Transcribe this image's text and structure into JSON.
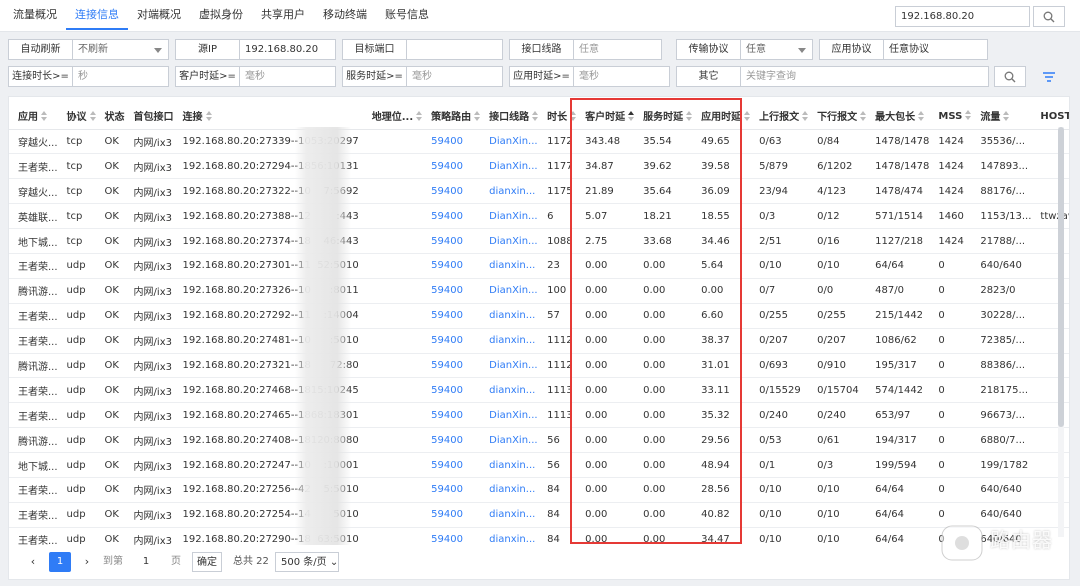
{
  "tabs": [
    {
      "label": "流量概况",
      "active": false
    },
    {
      "label": "连接信息",
      "active": true
    },
    {
      "label": "对端概况",
      "active": false
    },
    {
      "label": "虚拟身份",
      "active": false
    },
    {
      "label": "共享用户",
      "active": false
    },
    {
      "label": "移动终端",
      "active": false
    },
    {
      "label": "账号信息",
      "active": false
    }
  ],
  "global_search": {
    "value": "192.168.80.20",
    "icon": "search-icon"
  },
  "filters": {
    "auto_refresh": {
      "label": "自动刷新",
      "value": "不刷新"
    },
    "src_ip": {
      "label": "源IP",
      "value": "192.168.80.20"
    },
    "dst_port": {
      "label": "目标端口",
      "value": ""
    },
    "iface_line": {
      "label": "接口线路",
      "placeholder": "任意"
    },
    "transport": {
      "label": "传输协议",
      "value": "任意"
    },
    "app_proto": {
      "label": "应用协议",
      "value": "任意协议"
    },
    "conn_duration": {
      "label": "连接时长>=",
      "placeholder": "秒"
    },
    "client_delay": {
      "label": "客户时延>=",
      "placeholder": "毫秒"
    },
    "server_delay": {
      "label": "服务时延>=",
      "placeholder": "毫秒"
    },
    "app_delay": {
      "label": "应用时延>=",
      "placeholder": "毫秒"
    },
    "other": {
      "label": "其它",
      "placeholder": "关键字查询"
    }
  },
  "columns": [
    "应用",
    "协议",
    "状态",
    "首包接口",
    "连接",
    "地理位...",
    "策略路由",
    "接口线路",
    "时长",
    "客户时延",
    "服务时延",
    "应用时延",
    "上行报文",
    "下行报文",
    "最大包长",
    "MSS",
    "流量",
    "HOST"
  ],
  "rows": [
    [
      "穿越火...",
      "tcp",
      "OK",
      "内网/ix3",
      "192.168.80.20:27339--10",
      "53:20297",
      "",
      "59400",
      "DianXin...",
      "1172",
      "343.48",
      "35.54",
      "49.65",
      "0/63",
      "0/84",
      "1478/1478",
      "1424",
      "35536/...",
      ""
    ],
    [
      "王者荣...",
      "tcp",
      "OK",
      "内网/ix3",
      "192.168.80.20:27294--18",
      "56:10131",
      "",
      "59400",
      "DianXin...",
      "1177",
      "34.87",
      "39.62",
      "39.58",
      "5/879",
      "6/1202",
      "1478/1478",
      "1424",
      "147893...",
      ""
    ],
    [
      "穿越火...",
      "tcp",
      "OK",
      "内网/ix3",
      "192.168.80.20:27322--10",
      "7:5692",
      "",
      "59400",
      "dianxin...",
      "1175",
      "21.89",
      "35.64",
      "36.09",
      "23/94",
      "4/123",
      "1478/474",
      "1424",
      "88176/...",
      ""
    ],
    [
      "英雄联...",
      "tcp",
      "OK",
      "内网/ix3",
      "192.168.80.20:27388--12",
      ":443",
      "",
      "59400",
      "DianXin...",
      "6",
      "5.07",
      "18.21",
      "18.55",
      "0/3",
      "0/12",
      "571/1514",
      "1460",
      "1153/13...",
      "ttwzavat..."
    ],
    [
      "地下城...",
      "tcp",
      "OK",
      "内网/ix3",
      "192.168.80.20:27374--18",
      "46:443",
      "",
      "59400",
      "DianXin...",
      "1088",
      "2.75",
      "33.68",
      "34.46",
      "2/51",
      "0/16",
      "1127/218",
      "1424",
      "21788/...",
      ""
    ],
    [
      "王者荣...",
      "udp",
      "OK",
      "内网/ix3",
      "192.168.80.20:27301--11",
      "52:5010",
      "",
      "59400",
      "dianxin...",
      "23",
      "0.00",
      "0.00",
      "5.64",
      "0/10",
      "0/10",
      "64/64",
      "0",
      "640/640",
      ""
    ],
    [
      "腾讯游...",
      "udp",
      "OK",
      "内网/ix3",
      "192.168.80.20:27326--10",
      ":8011",
      "",
      "59400",
      "DianXin...",
      "100",
      "0.00",
      "0.00",
      "0.00",
      "0/7",
      "0/0",
      "487/0",
      "0",
      "2823/0",
      ""
    ],
    [
      "王者荣...",
      "udp",
      "OK",
      "内网/ix3",
      "192.168.80.20:27292--11",
      ":14004",
      "",
      "59400",
      "dianxin...",
      "57",
      "0.00",
      "0.00",
      "6.60",
      "0/255",
      "0/255",
      "215/1442",
      "0",
      "30228/...",
      ""
    ],
    [
      "王者荣...",
      "udp",
      "OK",
      "内网/ix3",
      "192.168.80.20:27481--10",
      ":5010",
      "",
      "59400",
      "dianxin...",
      "1112",
      "0.00",
      "0.00",
      "38.37",
      "0/207",
      "0/207",
      "1086/62",
      "0",
      "72385/...",
      ""
    ],
    [
      "腾讯游...",
      "udp",
      "OK",
      "内网/ix3",
      "192.168.80.20:27321--18",
      "72:80",
      "",
      "59400",
      "DianXin...",
      "1112",
      "0.00",
      "0.00",
      "31.01",
      "0/693",
      "0/910",
      "195/317",
      "0",
      "88386/...",
      ""
    ],
    [
      "王者荣...",
      "udp",
      "OK",
      "内网/ix3",
      "192.168.80.20:27468--18",
      "15:10245",
      "",
      "59400",
      "dianxin...",
      "1113",
      "0.00",
      "0.00",
      "33.11",
      "0/15529",
      "0/15704",
      "574/1442",
      "0",
      "218175...",
      ""
    ],
    [
      "王者荣...",
      "udp",
      "OK",
      "内网/ix3",
      "192.168.80.20:27465--18",
      "68:18301",
      "",
      "59400",
      "DianXin...",
      "1113",
      "0.00",
      "0.00",
      "35.32",
      "0/240",
      "0/240",
      "653/97",
      "0",
      "96673/...",
      ""
    ],
    [
      "腾讯游...",
      "udp",
      "OK",
      "内网/ix3",
      "192.168.80.20:27408--18",
      "120:8080",
      "",
      "59400",
      "DianXin...",
      "56",
      "0.00",
      "0.00",
      "29.56",
      "0/53",
      "0/61",
      "194/317",
      "0",
      "6880/7...",
      ""
    ],
    [
      "地下城...",
      "udp",
      "OK",
      "内网/ix3",
      "192.168.80.20:27247--10",
      ":10001",
      "",
      "59400",
      "dianxin...",
      "56",
      "0.00",
      "0.00",
      "48.94",
      "0/1",
      "0/3",
      "199/594",
      "0",
      "199/1782",
      ""
    ],
    [
      "王者荣...",
      "udp",
      "OK",
      "内网/ix3",
      "192.168.80.20:27256--42",
      "5:5010",
      "",
      "59400",
      "dianxin...",
      "84",
      "0.00",
      "0.00",
      "28.56",
      "0/10",
      "0/10",
      "64/64",
      "0",
      "640/640",
      ""
    ],
    [
      "王者荣...",
      "udp",
      "OK",
      "内网/ix3",
      "192.168.80.20:27254--14",
      "5010",
      "",
      "59400",
      "dianxin...",
      "84",
      "0.00",
      "0.00",
      "40.82",
      "0/10",
      "0/10",
      "64/64",
      "0",
      "640/640",
      ""
    ],
    [
      "王者荣...",
      "udp",
      "OK",
      "内网/ix3",
      "192.168.80.20:27290--18",
      "63:5010",
      "",
      "59400",
      "dianxin...",
      "84",
      "0.00",
      "0.00",
      "34.47",
      "0/10",
      "0/10",
      "64/64",
      "0",
      "640/640",
      ""
    ]
  ],
  "pagination": {
    "current_page": "1",
    "goto_label": "到第",
    "goto_value": "1",
    "page_unit": "页",
    "confirm": "确定",
    "total": "总共 22",
    "page_size": "500 条/页"
  },
  "watermark": {
    "text": "路由器"
  },
  "colors": {
    "accent": "#2f7cf6",
    "highlight": "#e53935"
  }
}
